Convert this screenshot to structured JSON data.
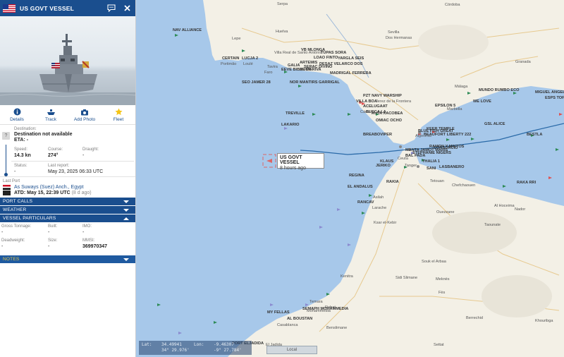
{
  "header": {
    "vessel_name": "US GOVT VESSEL",
    "flag": "us-flag-icon"
  },
  "actions": [
    {
      "label": "Details",
      "icon": "info-icon"
    },
    {
      "label": "Track",
      "icon": "ship-track-icon"
    },
    {
      "label": "Add Photo",
      "icon": "camera-icon"
    },
    {
      "label": "Fleet",
      "icon": "star-icon"
    }
  ],
  "voyage": {
    "destination_label": "Destination:",
    "destination_value": "Destination not available",
    "eta_label": "ETA: -",
    "speed_label": "Speed:",
    "speed_value": "14.3 kn",
    "course_label": "Course:",
    "course_value": "274°",
    "draught_label": "Draught:",
    "draught_value": "-",
    "status_label": "Status:",
    "status_value": "-",
    "last_report_label": "Last report:",
    "last_report_value": "May 23, 2025 06:33 UTC",
    "last_port_label": "Last Port",
    "last_port_value": "As Suways (Suez) Anch., Egypt",
    "atd_value": "ATD: May 15, 22:39 UTC",
    "atd_ago": "(8 d ago)"
  },
  "sections": {
    "port_calls": "PORT CALLS",
    "weather": "WEATHER",
    "vessel_particulars": "VESSEL PARTICULARS",
    "notes": "NOTES"
  },
  "particulars": {
    "gross_tonnage_label": "Gross Tonnage:",
    "gross_tonnage_value": "-",
    "built_label": "Built:",
    "built_value": "-",
    "imo_label": "IMO:",
    "imo_value": "-",
    "deadweight_label": "Deadweight:",
    "deadweight_value": "-",
    "size_label": "Size:",
    "size_value": "-",
    "mmsi_label": "MMSI:",
    "mmsi_value": "369970347"
  },
  "map": {
    "popup_title": "US GOVT VESSEL",
    "popup_sub": "8 hours ago",
    "coords": {
      "lat_label": "Lat:",
      "lat_dec": "34.49941",
      "lat_dms": "34° 29.976'",
      "lon_label": "Lon:",
      "lon_dec": "-9.46307",
      "lon_dms": "-9° 27.784'"
    },
    "scale_button": "Local",
    "ship_labels": [
      "NAV ALLIANCE",
      "CERTAIN",
      "LUCJA 2",
      "VB MLONGA",
      "TUPAS SORA",
      "LOAO FINTO",
      "YARGLA SEIS",
      "ARTEMIS",
      "SERAC DIVINO",
      "GALIA",
      "DESAZ VELARCO DOS",
      "EEVE BIBURCA",
      "AL MARIVA",
      "MADRIGAL FERRERA",
      "NOR MANTIRS GARRIGAL",
      "SEO JAMER 28",
      "PZT NAVY WARSHIP",
      "VILLA BOA",
      "ACELUGAAT",
      "BUSCA LA",
      "RUTA XACOBEA",
      "OMIAC OCHO",
      "TREVILLE",
      "LAKARIO",
      "BREABOVIPER",
      "EPSILON 5",
      "KEER TEMPLE",
      "WE LOVE",
      "MUNDO RUMBO ECO",
      "MIGUEL ANGEL",
      "ESPS TOFINO",
      "BLUE FISH GREAT",
      "BEAUFORT LIBERTY 222",
      "GSL ALICE",
      "BESTLA",
      "CONSORCIO",
      "RAMON Y MIKTOS",
      "MANTA JAMOT MARIS",
      "STEPHANIE NIGERS",
      "BAL PADA",
      "THALIA 1",
      "KLAUS",
      "JERIKO",
      "LASBANERO",
      "SANI",
      "REGINA",
      "EL ANDALUS",
      "RAKIA",
      "RAKA RRI",
      "RANCAV",
      "MY FELLAS",
      "SEMAPH MOHAMMEDIA",
      "AL BOUSTAN",
      "PORT ELJADIDA"
    ],
    "town_labels": [
      "Serpa",
      "Córdoba",
      "Huelva",
      "Sevilla",
      "Dos Hermanas",
      "Lepe",
      "Portimão",
      "Loulé",
      "Faro",
      "Cádiz",
      "Ceuta",
      "Tanger",
      "Tetouan",
      "Asilah",
      "Larache",
      "Ksar el-Kebir",
      "Kenitra",
      "Rabat",
      "Casablanca",
      "Mohammedia",
      "Sidi Slimane",
      "Meknès",
      "Fès",
      "El Jadida",
      "Jerez de la Frontera",
      "Marbella",
      "Málaga",
      "Granada",
      "Algeciras",
      "Nador",
      "Al Hoceima",
      "Berrechid",
      "Settat",
      "Khouribga",
      "Temara",
      "Benslimane",
      "Souk el Arbaa",
      "Villa Real de Santo António",
      "Tavira",
      "Chefchaouen",
      "Ouezzane",
      "Taounate"
    ]
  }
}
